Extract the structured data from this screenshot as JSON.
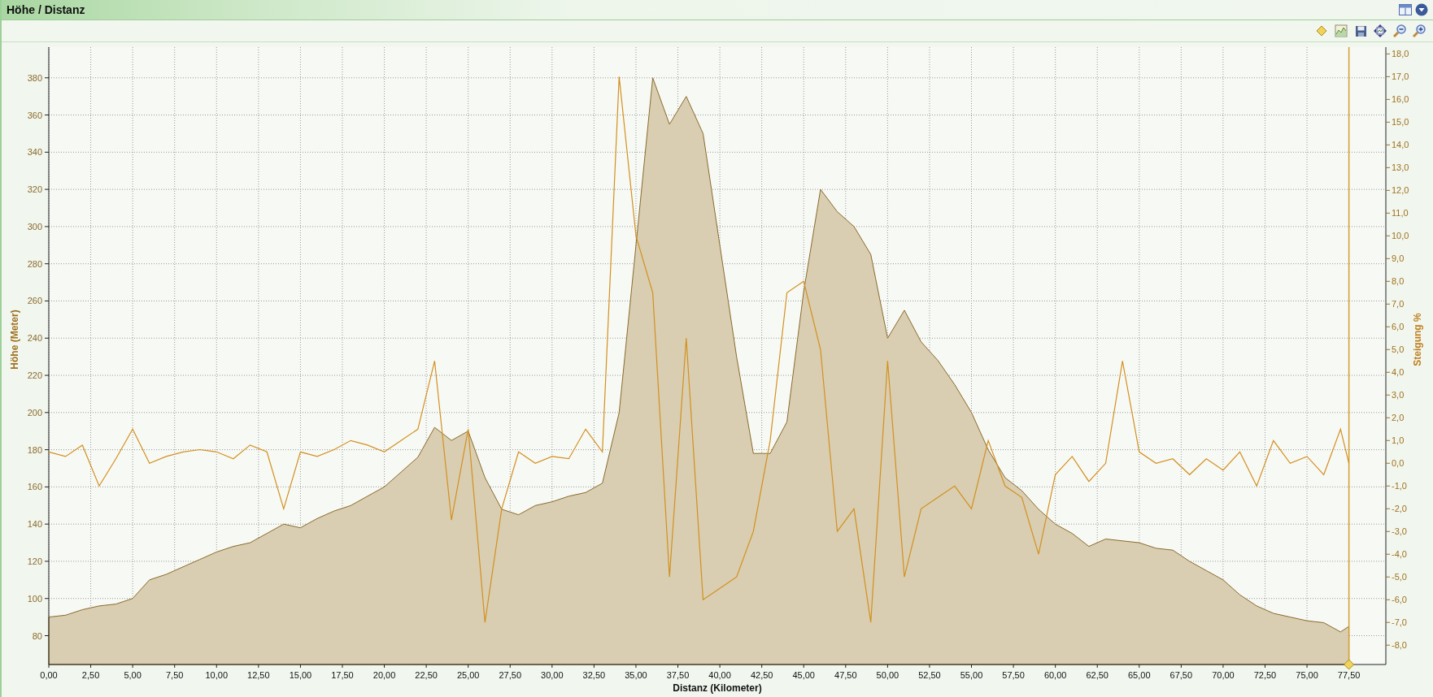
{
  "window": {
    "title": "Höhe / Distanz"
  },
  "toolbar": {
    "buttons": [
      {
        "kind": "marker"
      },
      {
        "kind": "chart"
      },
      {
        "kind": "save"
      },
      {
        "kind": "move"
      },
      {
        "kind": "zoom-out"
      },
      {
        "kind": "zoom-in"
      }
    ]
  },
  "elevation": {
    "chart_data": {
      "type": "area",
      "xlabel": "Distanz (Kilometer)",
      "ylabel": "Höhe (Meter)",
      "xlim": [
        0,
        79.7
      ],
      "ylim": [
        64.5,
        396.5
      ],
      "xticks": [
        {
          "value": 0,
          "label": "0,00"
        },
        {
          "value": 2.5,
          "label": "2,50"
        },
        {
          "value": 5,
          "label": "5,00"
        },
        {
          "value": 7.5,
          "label": "7,50"
        },
        {
          "value": 10,
          "label": "10,00"
        },
        {
          "value": 12.5,
          "label": "12,50"
        },
        {
          "value": 15,
          "label": "15,00"
        },
        {
          "value": 17.5,
          "label": "17,50"
        },
        {
          "value": 20,
          "label": "20,00"
        },
        {
          "value": 22.5,
          "label": "22,50"
        },
        {
          "value": 25,
          "label": "25,00"
        },
        {
          "value": 27.5,
          "label": "27,50"
        },
        {
          "value": 30,
          "label": "30,00"
        },
        {
          "value": 32.5,
          "label": "32,50"
        },
        {
          "value": 35,
          "label": "35,00"
        },
        {
          "value": 37.5,
          "label": "37,50"
        },
        {
          "value": 40,
          "label": "40,00"
        },
        {
          "value": 42.5,
          "label": "42,50"
        },
        {
          "value": 45,
          "label": "45,00"
        },
        {
          "value": 47.5,
          "label": "47,50"
        },
        {
          "value": 50,
          "label": "50,00"
        },
        {
          "value": 52.5,
          "label": "52,50"
        },
        {
          "value": 55,
          "label": "55,00"
        },
        {
          "value": 57.5,
          "label": "57,50"
        },
        {
          "value": 60,
          "label": "60,00"
        },
        {
          "value": 62.5,
          "label": "62,50"
        },
        {
          "value": 65,
          "label": "65,00"
        },
        {
          "value": 67.5,
          "label": "67,50"
        },
        {
          "value": 70,
          "label": "70,00"
        },
        {
          "value": 72.5,
          "label": "72,50"
        },
        {
          "value": 75,
          "label": "75,00"
        },
        {
          "value": 77.5,
          "label": "77,50"
        }
      ],
      "yticks": [
        80,
        100,
        120,
        140,
        160,
        180,
        200,
        220,
        240,
        260,
        280,
        300,
        320,
        340,
        360,
        380
      ],
      "x": [
        0,
        1,
        2,
        3,
        4,
        5,
        6,
        7,
        8,
        9,
        10,
        11,
        12,
        13,
        14,
        15,
        16,
        17,
        18,
        19,
        20,
        21,
        22,
        23,
        24,
        25,
        26,
        27,
        28,
        29,
        30,
        31,
        32,
        33,
        34,
        35,
        36,
        37,
        38,
        39,
        40,
        41,
        42,
        43,
        44,
        45,
        46,
        47,
        48,
        49,
        50,
        51,
        52,
        53,
        54,
        55,
        56,
        57,
        58,
        59,
        60,
        61,
        62,
        63,
        64,
        65,
        66,
        67,
        68,
        69,
        70,
        71,
        72,
        73,
        74,
        75,
        76,
        77,
        77.5
      ],
      "series": [
        {
          "color": "#8b6a2b",
          "values": [
            90,
            91,
            94,
            96,
            97,
            100,
            110,
            113,
            117,
            121,
            125,
            128,
            130,
            135,
            140,
            138,
            143,
            147,
            150,
            155,
            160,
            168,
            176,
            192,
            185,
            190,
            165,
            148,
            145,
            150,
            152,
            155,
            157,
            162,
            200,
            290,
            380,
            355,
            370,
            350,
            290,
            230,
            178,
            178,
            195,
            265,
            320,
            308,
            300,
            285,
            240,
            255,
            238,
            228,
            215,
            200,
            180,
            165,
            158,
            148,
            140,
            135,
            128,
            132,
            131,
            130,
            127,
            126,
            120,
            115,
            110,
            102,
            96,
            92,
            90,
            88,
            87,
            82,
            85
          ]
        }
      ],
      "grid": true,
      "ref_lines": [
        {
          "axis": "x",
          "value": 77.5
        }
      ]
    }
  },
  "gradient": {
    "chart_data": {
      "type": "line",
      "ylabel": "Steigung %",
      "xlim": [
        0,
        79.7
      ],
      "ylim": [
        -8.85,
        18.3
      ],
      "yticks": [
        {
          "value": 18,
          "label": "18,0"
        },
        {
          "value": 17,
          "label": "17,0"
        },
        {
          "value": 16,
          "label": "16,0"
        },
        {
          "value": 15,
          "label": "15,0"
        },
        {
          "value": 14,
          "label": "14,0"
        },
        {
          "value": 13,
          "label": "13,0"
        },
        {
          "value": 12,
          "label": "12,0"
        },
        {
          "value": 11,
          "label": "11,0"
        },
        {
          "value": 10,
          "label": "10,0"
        },
        {
          "value": 9,
          "label": "9,0"
        },
        {
          "value": 8,
          "label": "8,0"
        },
        {
          "value": 7,
          "label": "7,0"
        },
        {
          "value": 6,
          "label": "6,0"
        },
        {
          "value": 5,
          "label": "5,0"
        },
        {
          "value": 4,
          "label": "4,0"
        },
        {
          "value": 3,
          "label": "3,0"
        },
        {
          "value": 2,
          "label": "2,0"
        },
        {
          "value": 1,
          "label": "1,0"
        },
        {
          "value": 0,
          "label": "0,0"
        },
        {
          "value": -1,
          "label": "-1,0"
        },
        {
          "value": -2,
          "label": "-2,0"
        },
        {
          "value": -3,
          "label": "-3,0"
        },
        {
          "value": -4,
          "label": "-4,0"
        },
        {
          "value": -5,
          "label": "-5,0"
        },
        {
          "value": -6,
          "label": "-6,0"
        },
        {
          "value": -7,
          "label": "-7,0"
        },
        {
          "value": -8,
          "label": "-8,0"
        }
      ],
      "x": [
        0,
        1,
        2,
        3,
        4,
        5,
        6,
        7,
        8,
        9,
        10,
        11,
        12,
        13,
        14,
        15,
        16,
        17,
        18,
        19,
        20,
        21,
        22,
        23,
        24,
        25,
        26,
        27,
        28,
        29,
        30,
        31,
        32,
        33,
        34,
        35,
        36,
        37,
        38,
        39,
        40,
        41,
        42,
        43,
        44,
        45,
        46,
        47,
        48,
        49,
        50,
        51,
        52,
        53,
        54,
        55,
        56,
        57,
        58,
        59,
        60,
        61,
        62,
        63,
        64,
        65,
        66,
        67,
        68,
        69,
        70,
        71,
        72,
        73,
        74,
        75,
        76,
        77,
        77.5
      ],
      "series": [
        {
          "color": "#d3901f",
          "values": [
            0.5,
            0.3,
            0.8,
            -1,
            0.2,
            1.5,
            0,
            0.3,
            0.5,
            0.6,
            0.5,
            0.2,
            0.8,
            0.5,
            -2,
            0.5,
            0.3,
            0.6,
            1,
            0.8,
            0.5,
            1,
            1.5,
            4.5,
            -2.5,
            1.5,
            -7,
            -2,
            0.5,
            0,
            0.3,
            0.2,
            1.5,
            0.5,
            17,
            10,
            7.5,
            -5,
            5.5,
            -6,
            -5.5,
            -5,
            -3,
            1,
            7.5,
            8,
            5,
            -3,
            -2,
            -7,
            4.5,
            -5,
            -2,
            -1.5,
            -1,
            -2,
            1,
            -1,
            -1.5,
            -4,
            -0.5,
            0.3,
            -0.8,
            0,
            4.5,
            0.5,
            0,
            0.2,
            -0.5,
            0.2,
            -0.3,
            0.5,
            -1,
            1,
            0,
            0.3,
            -0.5,
            1.5,
            0
          ]
        }
      ]
    }
  }
}
